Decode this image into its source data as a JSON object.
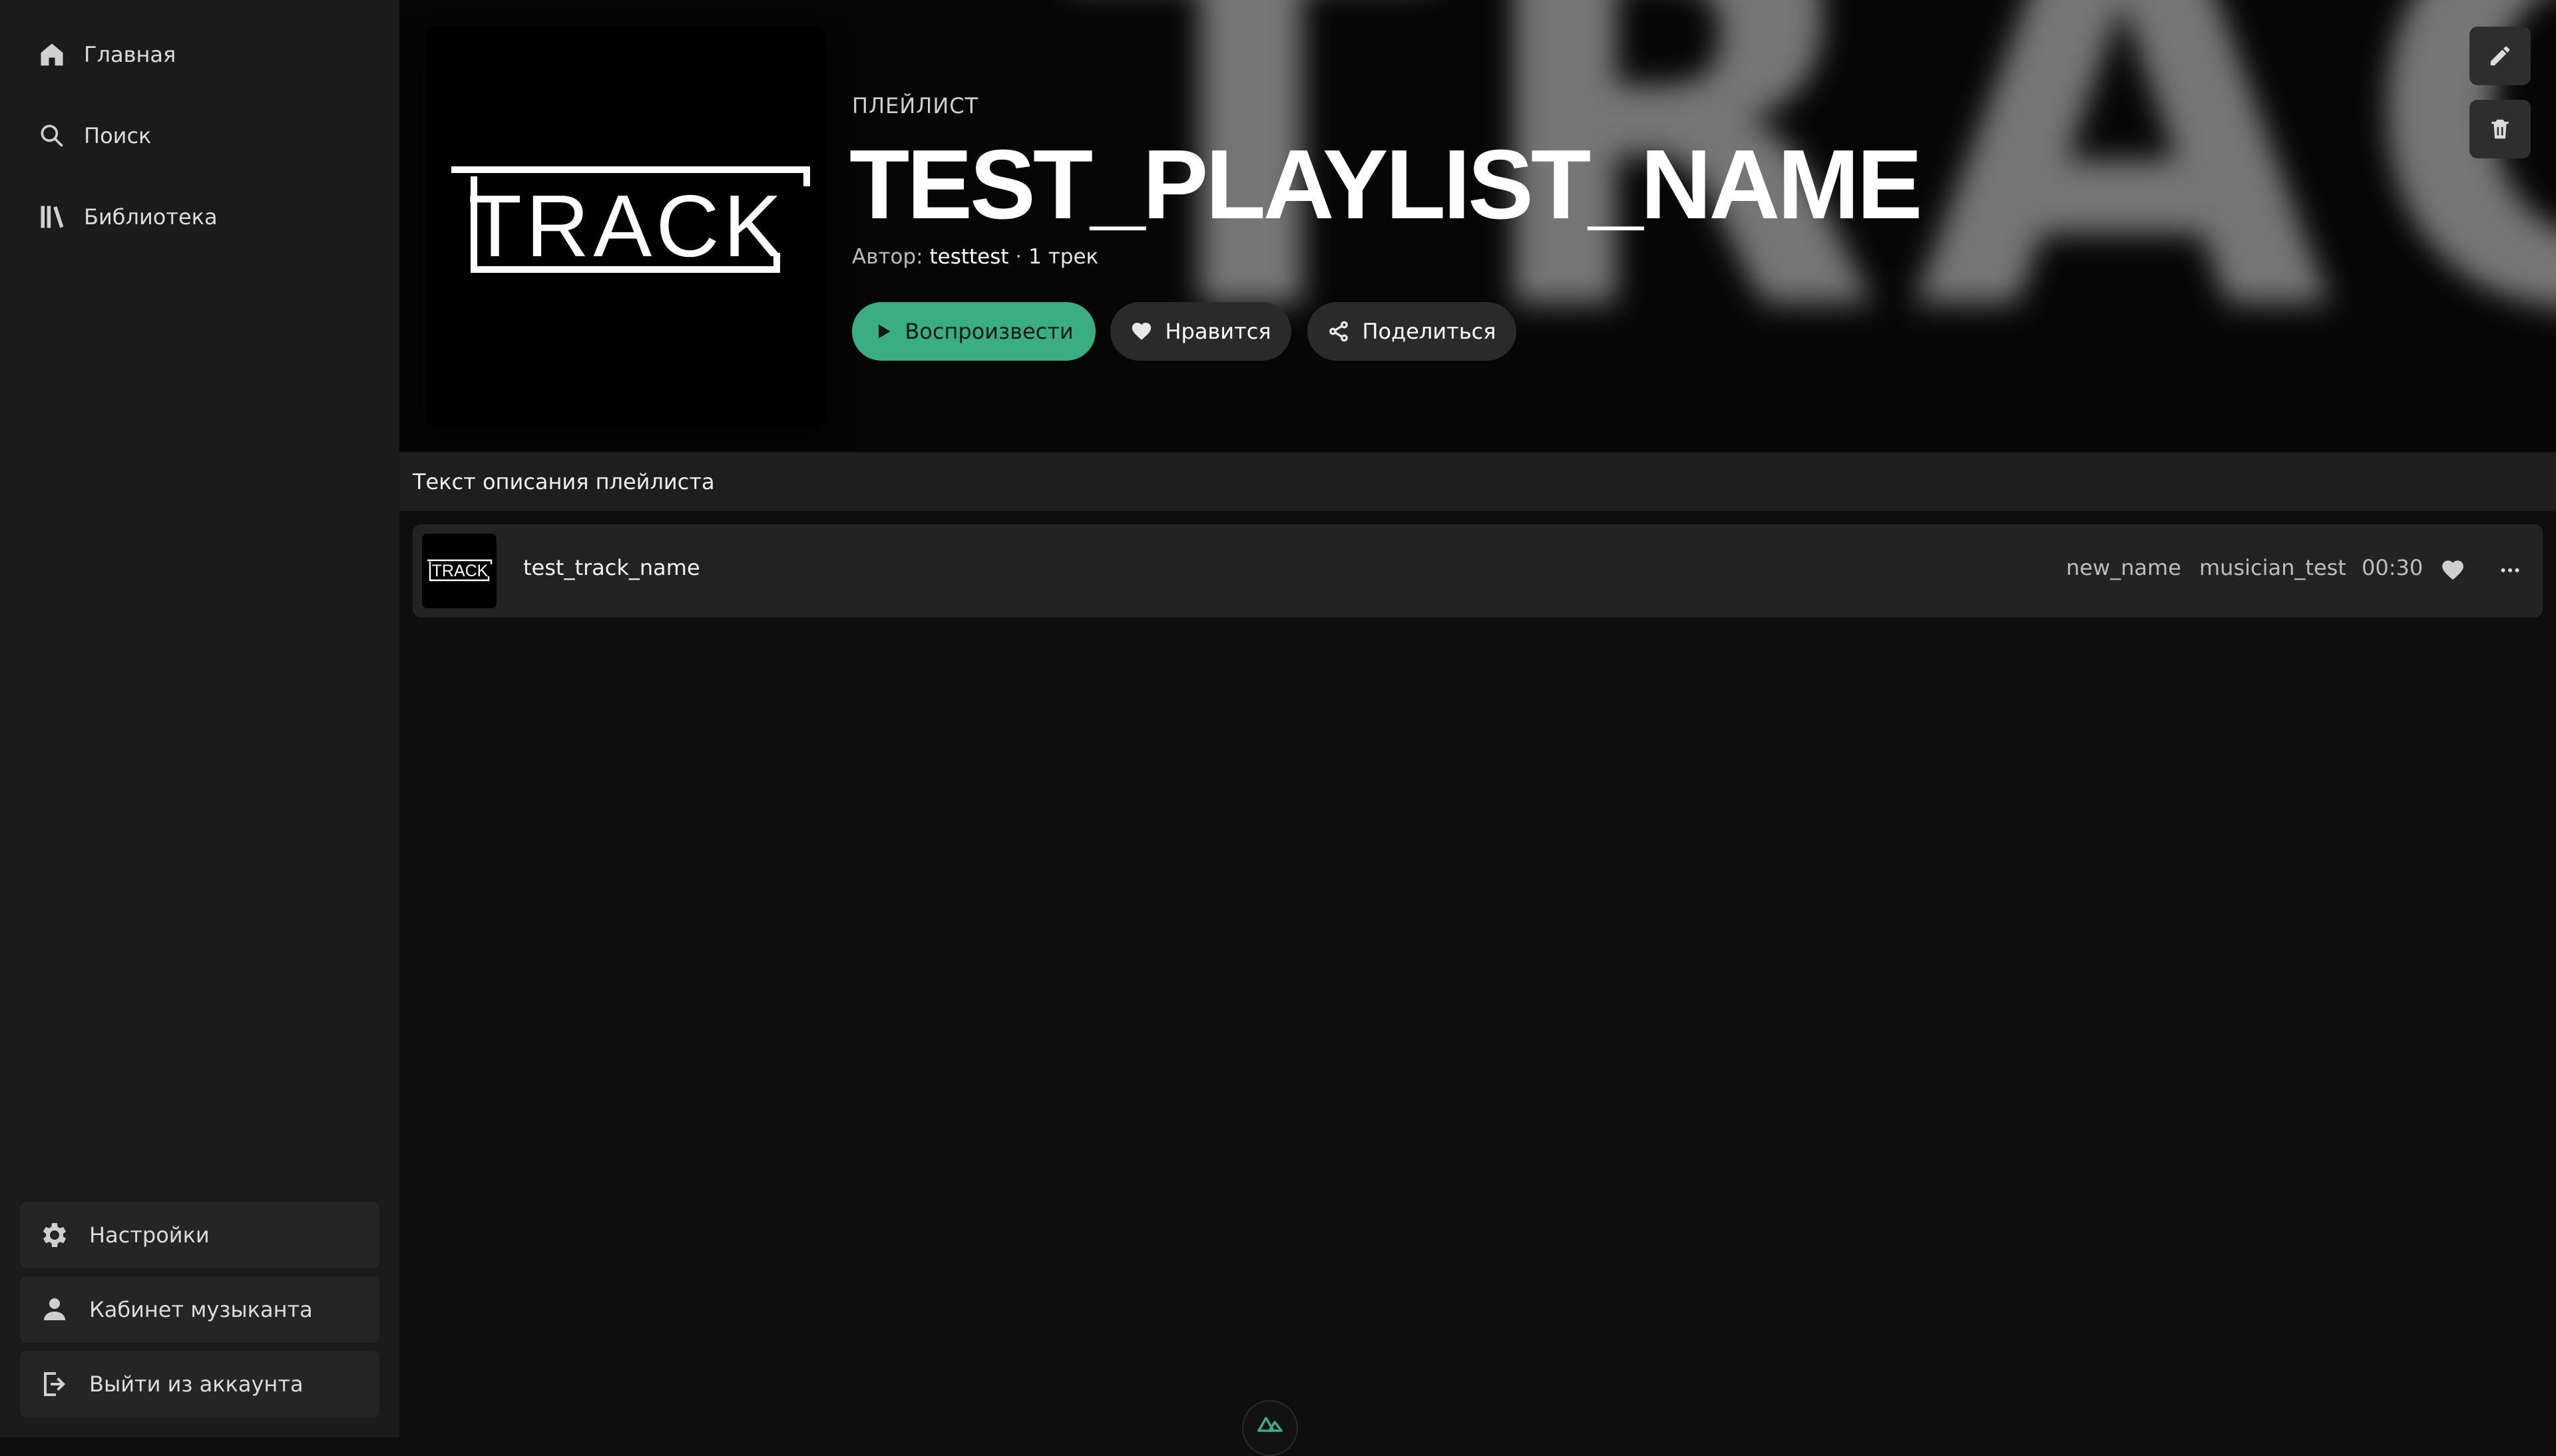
{
  "sidebar": {
    "nav": [
      {
        "label": "Главная",
        "icon": "home-icon"
      },
      {
        "label": "Поиск",
        "icon": "search-icon"
      },
      {
        "label": "Библиотека",
        "icon": "library-icon"
      }
    ],
    "bottom": [
      {
        "label": "Настройки",
        "icon": "gear-icon"
      },
      {
        "label": "Кабинет музыканта",
        "icon": "user-icon"
      },
      {
        "label": "Выйти из аккаунта",
        "icon": "logout-icon"
      }
    ]
  },
  "playlist": {
    "type_label": "ПЛЕЙЛИСТ",
    "title": "TEST_PLAYLIST_NAME",
    "author_prefix": "Автор: ",
    "author": "testtest",
    "separator": " · ",
    "track_count": "1 трек",
    "cover_text": "TRACK",
    "background_text": "TRACKI",
    "description": "Текст описания плейлиста"
  },
  "actions": {
    "play": "Воспроизвести",
    "like": "Нравится",
    "share": "Поделиться"
  },
  "tracks": [
    {
      "name": "test_track_name",
      "album": "new_name",
      "artist": "musician_test",
      "duration": "00:30",
      "cover_text": "TRACK"
    }
  ],
  "colors": {
    "accent": "#3aae82",
    "sidebar_bg": "#1b1b1b",
    "page_bg": "#0e0e0e",
    "row_bg": "#232323"
  }
}
